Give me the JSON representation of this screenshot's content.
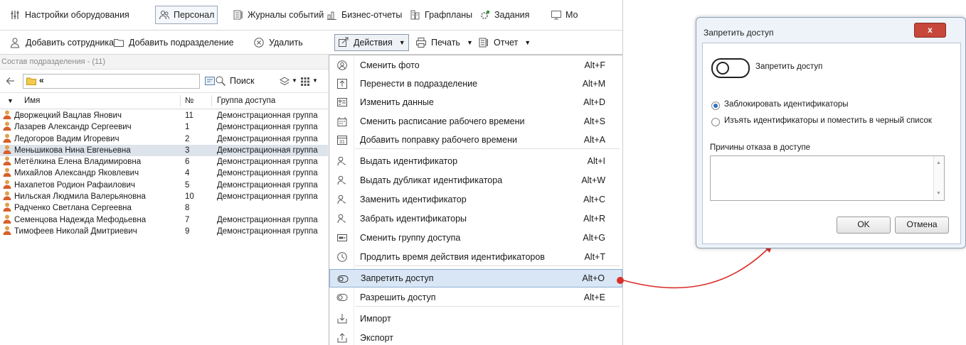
{
  "topbar": {
    "tabs": [
      {
        "label": "Настройки оборудования",
        "icon": "equipment-icon"
      },
      {
        "label": "Персонал",
        "icon": "people-icon",
        "active": true
      },
      {
        "label": "Журналы событий",
        "icon": "journal-icon"
      },
      {
        "label": "Бизнес-отчеты",
        "icon": "report-icon"
      },
      {
        "label": "Графпланы",
        "icon": "floorplan-icon"
      },
      {
        "label": "Задания",
        "icon": "tasks-icon"
      },
      {
        "label": "Мо",
        "icon": "monitor-icon"
      }
    ]
  },
  "toolbar": {
    "add_employee": "Добавить сотрудника",
    "add_department": "Добавить подразделение",
    "delete": "Удалить",
    "actions": "Действия",
    "print": "Печать",
    "report": "Отчет"
  },
  "panel": {
    "header": "Состав подразделения - (11)",
    "breadcrumb": "«",
    "search_label": "Поиск"
  },
  "table": {
    "columns": [
      "Имя",
      "№",
      "Группа доступа"
    ],
    "rows": [
      {
        "name": "Дворжецкий Вацлав Янович",
        "num": "11",
        "group": "Демонстрационная группа"
      },
      {
        "name": "Лазарев Александр Сергеевич",
        "num": "1",
        "group": "Демонстрационная группа"
      },
      {
        "name": "Ледогоров Вадим Игоревич",
        "num": "2",
        "group": "Демонстрационная группа"
      },
      {
        "name": "Меньшикова Нина Евгеньевна",
        "num": "3",
        "group": "Демонстрационная группа",
        "selected": true
      },
      {
        "name": "Метёлкина Елена Владимировна",
        "num": "6",
        "group": "Демонстрационная группа"
      },
      {
        "name": "Михайлов Александр Яковлевич",
        "num": "4",
        "group": "Демонстрационная группа"
      },
      {
        "name": "Нахапетов Родион Рафаилович",
        "num": "5",
        "group": "Демонстрационная группа"
      },
      {
        "name": "Нильская Людмила Валерьяновна",
        "num": "10",
        "group": "Демонстрационная группа"
      },
      {
        "name": "Радченко Светлана Сергеевна",
        "num": "8",
        "group": ""
      },
      {
        "name": "Семенцова Надежда Мефодьевна",
        "num": "7",
        "group": "Демонстрационная группа"
      },
      {
        "name": "Тимофеев Николай Дмитриевич",
        "num": "9",
        "group": "Демонстрационная группа"
      }
    ]
  },
  "menu": {
    "items": [
      {
        "label": "Сменить фото",
        "shortcut": "Alt+F",
        "icon": "photo-icon"
      },
      {
        "label": "Перенести в подразделение",
        "shortcut": "Alt+M",
        "icon": "move-icon"
      },
      {
        "label": "Изменить данные",
        "shortcut": "Alt+D",
        "icon": "edit-card-icon"
      },
      {
        "label": "Сменить расписание рабочего времени",
        "shortcut": "Alt+S",
        "icon": "schedule-icon"
      },
      {
        "label": "Добавить поправку рабочего времени",
        "shortcut": "Alt+A",
        "icon": "calendar-icon"
      },
      {
        "label": "Выдать идентификатор",
        "shortcut": "Alt+I",
        "icon": "id-issue-icon"
      },
      {
        "label": "Выдать дубликат идентификатора",
        "shortcut": "Alt+W",
        "icon": "id-duplicate-icon"
      },
      {
        "label": "Заменить идентификатор",
        "shortcut": "Alt+C",
        "icon": "id-replace-icon"
      },
      {
        "label": "Забрать идентификаторы",
        "shortcut": "Alt+R",
        "icon": "id-revoke-icon"
      },
      {
        "label": "Сменить группу доступа",
        "shortcut": "Alt+G",
        "icon": "access-group-icon"
      },
      {
        "label": "Продлить время действия идентификаторов",
        "shortcut": "Alt+T",
        "icon": "clock-icon"
      },
      {
        "label": "Запретить доступ",
        "shortcut": "Alt+O",
        "icon": "deny-access-icon",
        "highlighted": true
      },
      {
        "label": "Разрешить доступ",
        "shortcut": "Alt+E",
        "icon": "allow-access-icon"
      },
      {
        "label": "Импорт",
        "shortcut": "",
        "icon": "import-icon"
      },
      {
        "label": "Экспорт",
        "shortcut": "",
        "icon": "export-icon"
      }
    ]
  },
  "dialog": {
    "title": "Запретить доступ",
    "close": "x",
    "toggle_label": "Запретить доступ",
    "option1": "Заблокировать идентификаторы",
    "option2": "Изъять идентификаторы и поместить в черный список",
    "reason_label": "Причины отказа в доступе",
    "reason_value": "",
    "ok": "OK",
    "cancel": "Отмена"
  },
  "colors": {
    "selection": "#dde3ea",
    "menu_highlight": "#d9e6f5",
    "arrow": "#d9302a",
    "close_button": "#c7473a"
  }
}
